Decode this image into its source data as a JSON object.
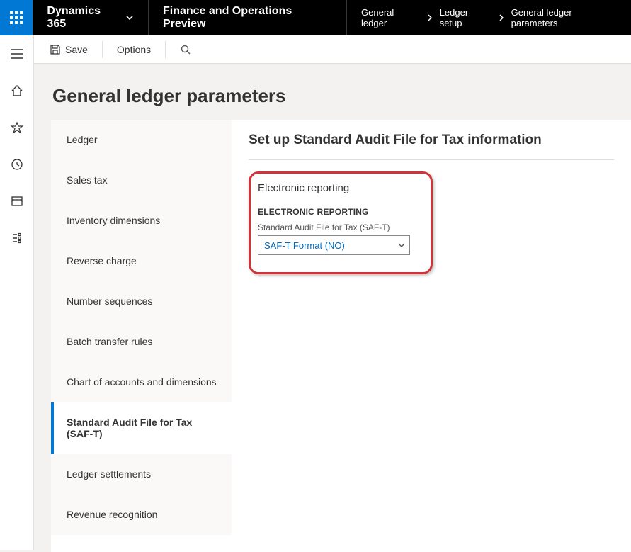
{
  "topbar": {
    "brand": "Dynamics 365",
    "module": "Finance and Operations Preview",
    "breadcrumbs": [
      "General ledger",
      "Ledger setup",
      "General ledger parameters"
    ]
  },
  "actionbar": {
    "save": "Save",
    "options": "Options"
  },
  "page": {
    "title": "General ledger parameters"
  },
  "side_tabs": [
    {
      "label": "Ledger",
      "active": false
    },
    {
      "label": "Sales tax",
      "active": false
    },
    {
      "label": "Inventory dimensions",
      "active": false
    },
    {
      "label": "Reverse charge",
      "active": false
    },
    {
      "label": "Number sequences",
      "active": false
    },
    {
      "label": "Batch transfer rules",
      "active": false
    },
    {
      "label": "Chart of accounts and dimensions",
      "active": false
    },
    {
      "label": "Standard Audit File for Tax (SAF-T)",
      "active": true
    },
    {
      "label": "Ledger settlements",
      "active": false
    },
    {
      "label": "Revenue recognition",
      "active": false
    }
  ],
  "tab_content": {
    "heading": "Set up Standard Audit File for Tax information",
    "accordion_title": "Electronic reporting",
    "group_label": "ELECTRONIC REPORTING",
    "field_label": "Standard Audit File for Tax (SAF-T)",
    "field_value": "SAF-T Format (NO)"
  }
}
